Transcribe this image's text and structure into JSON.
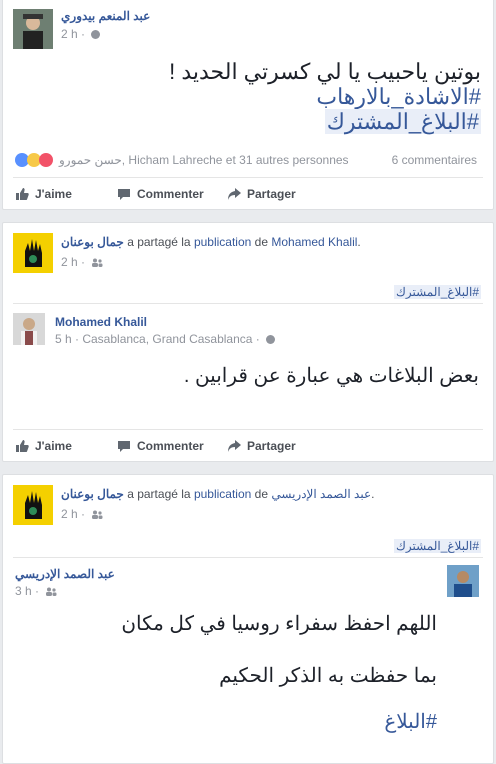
{
  "post1": {
    "author": "عبد المنعم بيدوري",
    "time": "2 h",
    "line1": "بوتين ياحبيب يا لي كسرتي الحديد !",
    "hashtag1": "#الاشادة_بالارهاب",
    "hashtag2": "#البلاغ_المشترك",
    "reactions_text": "حسن حمورو, Hicham Lahreche et 31 autres personnes",
    "comments": "6 commentaires"
  },
  "post2": {
    "sharer": "جمال بوعنان",
    "shared_text_1": "a partagé la",
    "shared_link": "publication",
    "shared_text_2": "de",
    "original_author": "Mohamed Khalil",
    "time": "2 h",
    "hashtag": "#البلاغ_المشترك",
    "inner_author": "Mohamed Khalil",
    "inner_meta": "5 h · Casablanca, Grand Casablanca ·",
    "inner_text": "بعض البلاغات هي عبارة عن قرابين ."
  },
  "post3": {
    "sharer": "جمال بوعنان",
    "shared_text_1": "a partagé la",
    "shared_link": "publication",
    "shared_text_2": "de",
    "original_author": "عبد الصمد الإدريسي",
    "time": "2 h",
    "hashtag": "#البلاغ_المشترك",
    "inner_author": "عبد الصمد الإدريسي",
    "inner_time": "3 h",
    "line1": "اللهم احفظ سفراء روسيا في كل مكان",
    "line2": "بما حفظت به الذكر الحكيم",
    "line3": "#البلاغ"
  },
  "actions": {
    "like": "J'aime",
    "comment": "Commenter",
    "share": "Partager"
  },
  "colors": {
    "link": "#365899",
    "page_bg": "#e9ebee",
    "meta": "#90949c",
    "hashtag_bg": "#e9eef8"
  }
}
